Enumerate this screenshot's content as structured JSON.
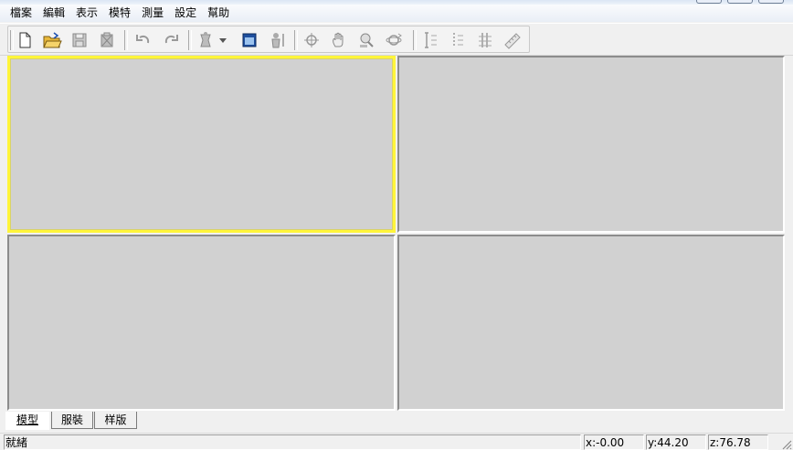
{
  "menubar": {
    "items": [
      "檔案",
      "編輯",
      "表示",
      "模特",
      "測量",
      "設定",
      "幫助"
    ]
  },
  "toolbar": {
    "buttons": [
      "new-file-icon",
      "open-folder-icon",
      "save-icon",
      "save-all-icon",
      "undo-icon",
      "redo-icon",
      "mannequin-icon",
      "dropdown-arrow-icon",
      "layout-view-icon",
      "figure-icon",
      "rotate-icon",
      "pan-hand-icon",
      "zoom-icon",
      "orbit-icon",
      "measure-vertical-icon",
      "measure-dotted-icon",
      "measure-multi-icon",
      "ruler-icon"
    ]
  },
  "tabs": [
    "模型",
    "服裝",
    "样版"
  ],
  "status": {
    "message": "就緒",
    "x": "x:-0.00",
    "y": "y:44.20",
    "z": "z:76.78"
  },
  "colors": {
    "viewport_bg": "#d1d1d1",
    "active_border": "#fff53a"
  }
}
